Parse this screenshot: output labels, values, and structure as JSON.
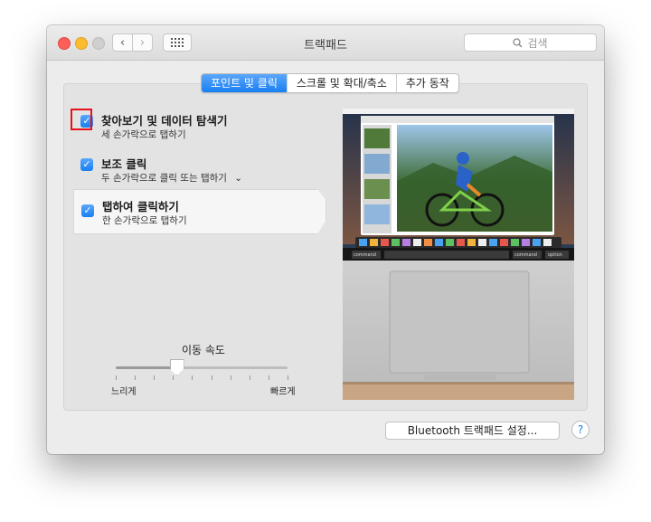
{
  "window": {
    "title": "트랙패드"
  },
  "toolbar": {
    "back_icon": "chevron-left-icon",
    "forward_icon": "chevron-right-icon",
    "grid_icon": "grid-icon",
    "search_placeholder": "검색",
    "search_icon": "search-icon"
  },
  "tabs": [
    {
      "label": "포인트 및 클릭",
      "active": true
    },
    {
      "label": "스크롤 및 확대/축소",
      "active": false
    },
    {
      "label": "추가 동작",
      "active": false
    }
  ],
  "options": [
    {
      "title": "찾아보기 및 데이터 탐색기",
      "subtitle": "세 손가락으로 탭하기",
      "checked": true
    },
    {
      "title": "보조 클릭",
      "subtitle": "두 손가락으로 클릭 또는 탭하기",
      "checked": true
    },
    {
      "title": "탭하여 클릭하기",
      "subtitle": "한 손가락으로 탭하기",
      "checked": true
    }
  ],
  "tracking": {
    "label": "이동 속도",
    "min_label": "느리게",
    "max_label": "빠르게",
    "ticks": 10,
    "value_fraction": 0.35
  },
  "preview": {
    "keys": [
      "command",
      "command",
      "option"
    ]
  },
  "bottom": {
    "bluetooth_button": "Bluetooth 트랙패드 설정...",
    "help": "?"
  },
  "colors": {
    "accent": "#1a7ff2",
    "highlight": "#e8101c"
  }
}
